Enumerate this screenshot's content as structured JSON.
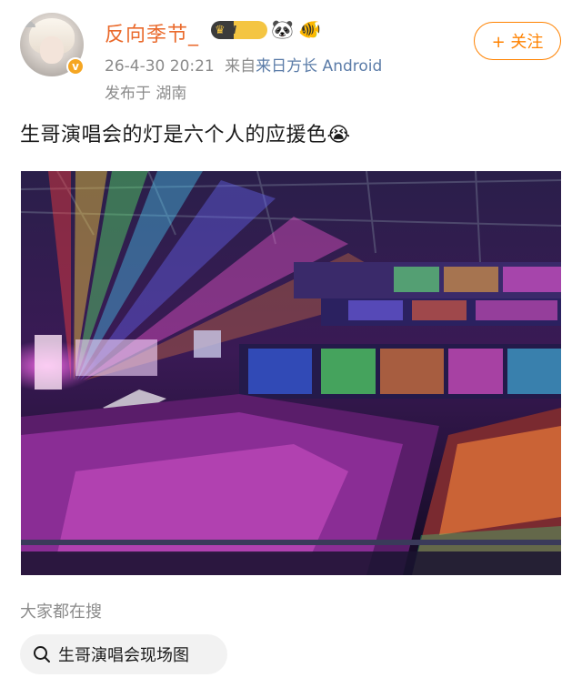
{
  "user": {
    "name": "反向季节_",
    "level": "I",
    "verified_mark": "v",
    "emoji_1": "🐼",
    "emoji_2": "🐠"
  },
  "meta": {
    "timestamp": "26-4-30 20:21",
    "source_prefix": "来自",
    "source": "来日方长 Android",
    "location": "发布于 湖南"
  },
  "follow_button": {
    "label": "+ 关注"
  },
  "post": {
    "text": "生哥演唱会的灯是六个人的应援色",
    "emoji": "😭"
  },
  "photo": {
    "description_icon": "concert-photo"
  },
  "search": {
    "section_label": "大家都在搜",
    "chip_label": "生哥演唱会现场图",
    "icon": "search-icon"
  },
  "colors": {
    "username": "#ea6a2c",
    "follow": "#ff8200",
    "meta": "#8b8b8b",
    "source_link": "#5b7ca8",
    "chip_bg": "#f2f2f2"
  }
}
